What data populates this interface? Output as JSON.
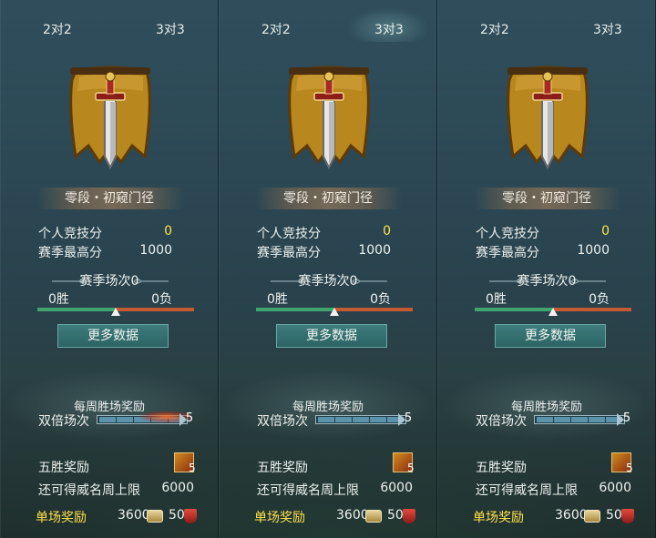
{
  "panels": [
    {
      "tabs": {
        "two": "2对2",
        "three": "3对3",
        "active": "none"
      },
      "rank": "零段・初窥门径",
      "personal_score_label": "个人竞技分",
      "personal_score": "0",
      "season_best_label": "赛季最高分",
      "season_best": "1000",
      "season_matches": "赛季场次0",
      "wins": "0胜",
      "losses": "0负",
      "win_ratio": 0.5,
      "more_button": "更多数据",
      "weekly_reward_title": "每周胜场奖励",
      "double_label": "双倍场次",
      "double_count": "5",
      "double_fire": true,
      "five_win_label": "五胜奖励",
      "five_win_count": "5",
      "fame_label": "还可得威名周上限",
      "fame_value": "6000",
      "single_label": "单场奖励",
      "single_coins": "3600",
      "single_medals": "50"
    },
    {
      "tabs": {
        "two": "2对2",
        "three": "3对3",
        "active": "three"
      },
      "rank": "零段・初窥门径",
      "personal_score_label": "个人竞技分",
      "personal_score": "0",
      "season_best_label": "赛季最高分",
      "season_best": "1000",
      "season_matches": "赛季场次0",
      "wins": "0胜",
      "losses": "0负",
      "win_ratio": 0.5,
      "more_button": "更多数据",
      "weekly_reward_title": "每周胜场奖励",
      "double_label": "双倍场次",
      "double_count": "5",
      "double_fire": false,
      "five_win_label": "五胜奖励",
      "five_win_count": "5",
      "fame_label": "还可得威名周上限",
      "fame_value": "6000",
      "single_label": "单场奖励",
      "single_coins": "3600",
      "single_medals": "50"
    },
    {
      "tabs": {
        "two": "2对2",
        "three": "3对3",
        "active": "none"
      },
      "rank": "零段・初窥门径",
      "personal_score_label": "个人竞技分",
      "personal_score": "0",
      "season_best_label": "赛季最高分",
      "season_best": "1000",
      "season_matches": "赛季场次0",
      "wins": "0胜",
      "losses": "0负",
      "win_ratio": 0.5,
      "more_button": "更多数据",
      "weekly_reward_title": "每周胜场奖励",
      "double_label": "双倍场次",
      "double_count": "5",
      "double_fire": false,
      "five_win_label": "五胜奖励",
      "five_win_count": "5",
      "fame_label": "还可得威名周上限",
      "fame_value": "6000",
      "single_label": "单场奖励",
      "single_coins": "3600",
      "single_medals": "50"
    }
  ],
  "colors": {
    "score_yellow": "#ffe04a",
    "win_bar": "#3fa46e",
    "loss_bar": "#c55a32",
    "button_teal": "#2d6465",
    "banner_gold": "#b8871e"
  }
}
